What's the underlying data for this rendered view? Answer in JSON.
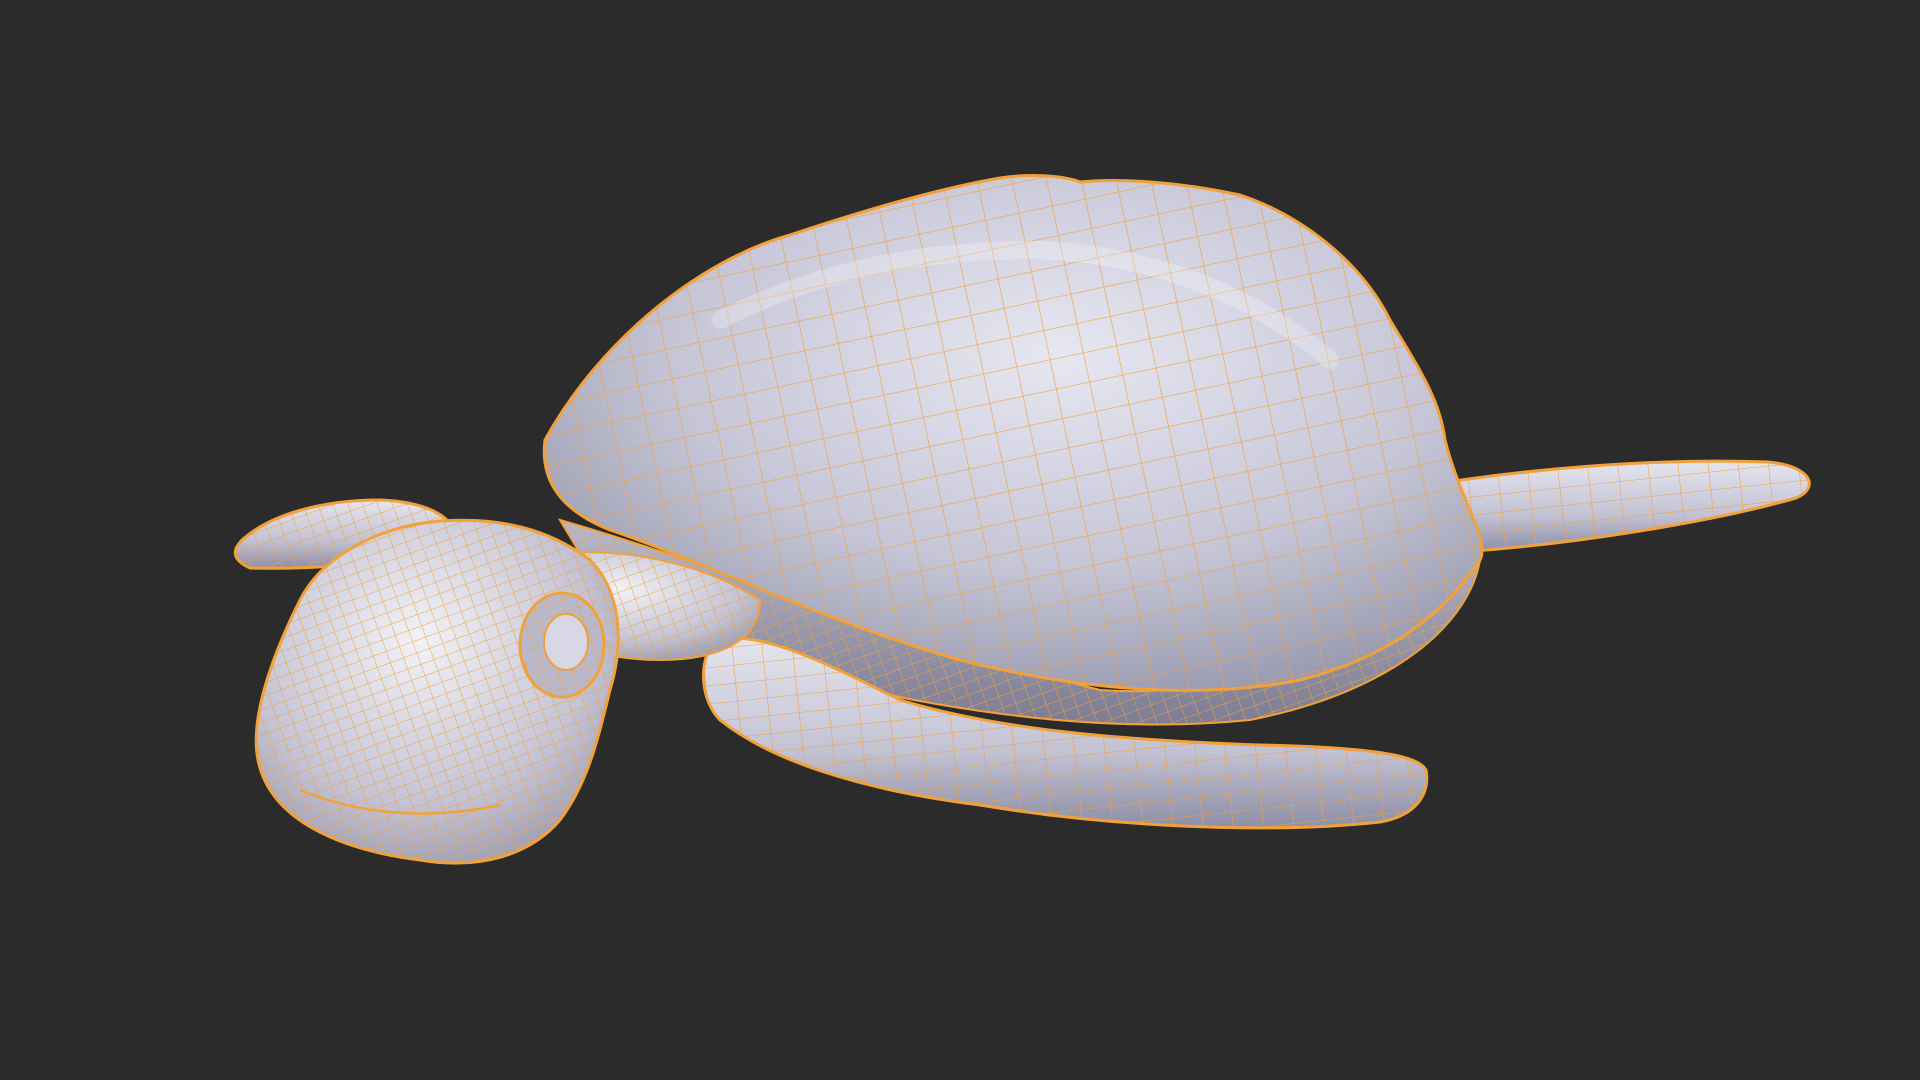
{
  "viewport": {
    "background_color": "#2b2b2b"
  },
  "model": {
    "subject": "sea-turtle-mesh",
    "shading": "solid",
    "overlay": "wireframe",
    "surface_color": "#c9c9d9",
    "wireframe_color": "#f2a13a",
    "parts": [
      "shell",
      "head",
      "eye",
      "front-left-flipper",
      "front-right-flipper",
      "rear-right-flipper"
    ]
  }
}
